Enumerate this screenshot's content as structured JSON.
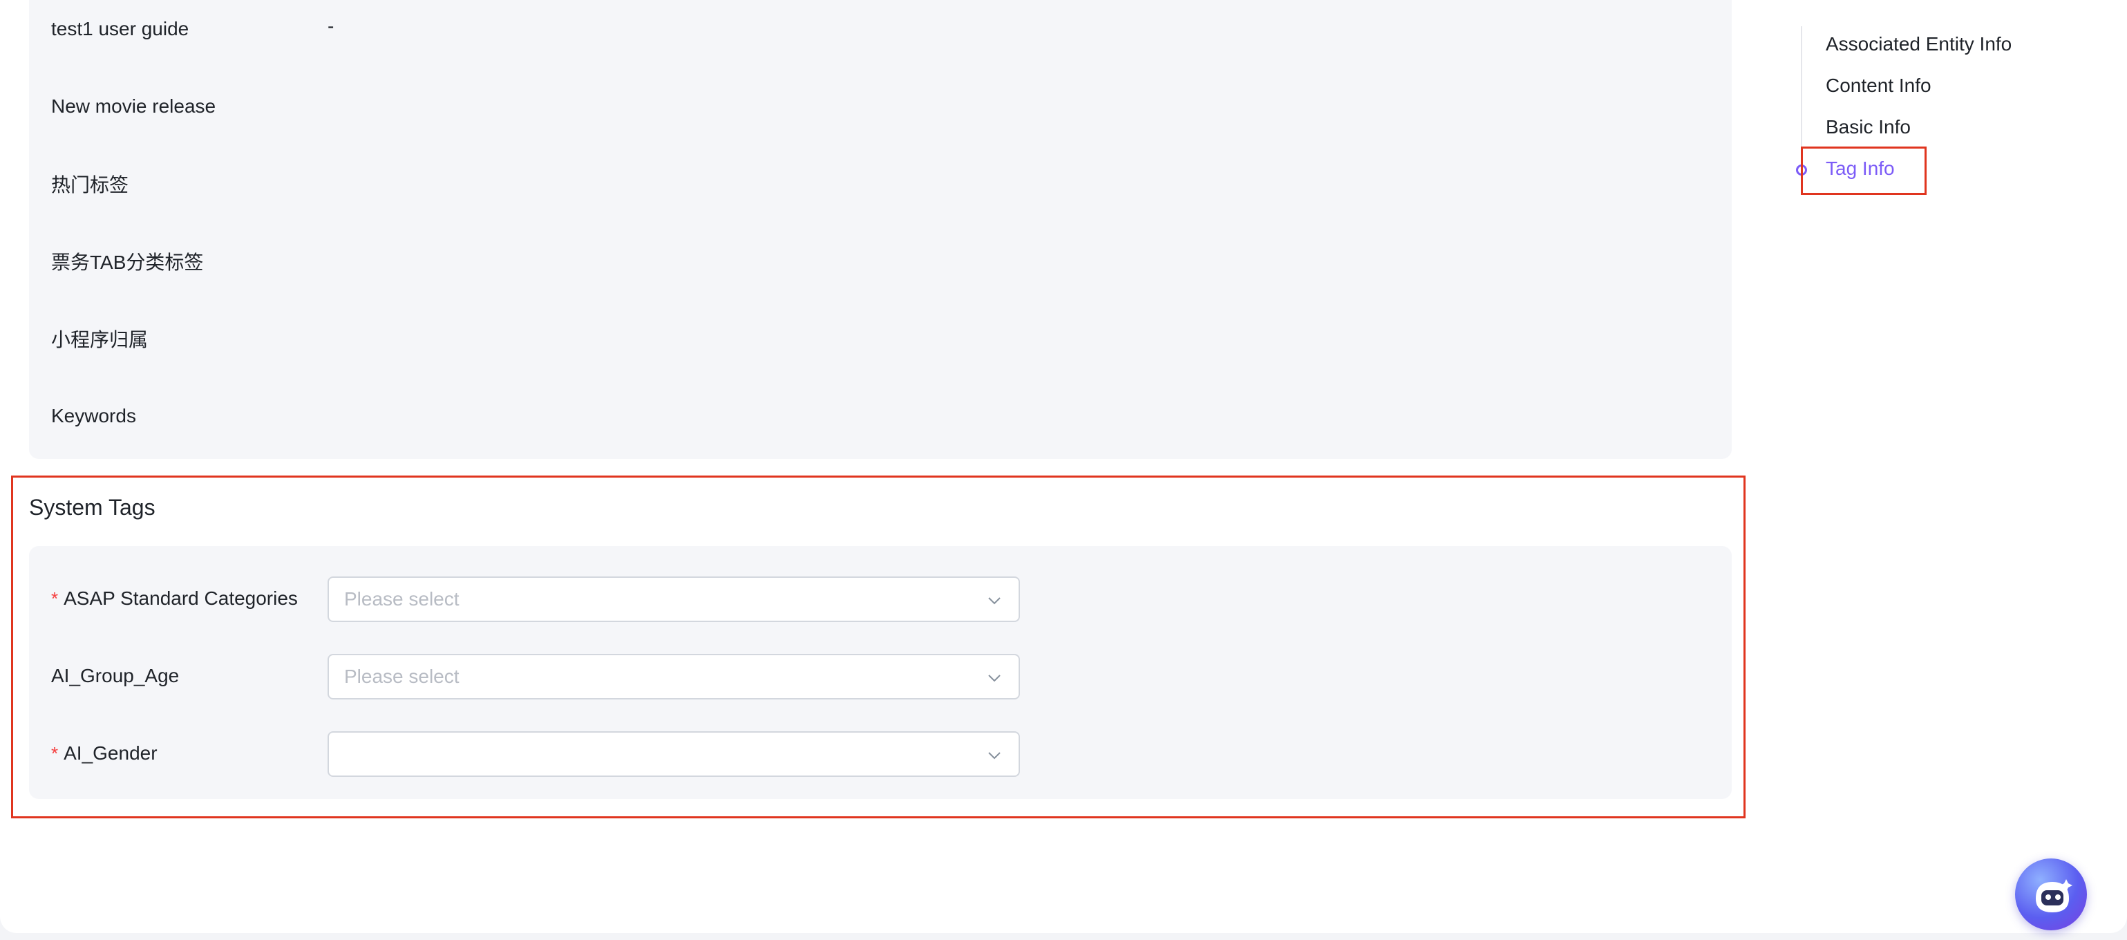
{
  "custom_tags": {
    "rows": [
      {
        "label": "test1 user guide",
        "value": "-"
      },
      {
        "label": "New movie release",
        "value": ""
      },
      {
        "label": "热门标签",
        "value": ""
      },
      {
        "label": "票务TAB分类标签",
        "value": ""
      },
      {
        "label": "小程序归属",
        "value": ""
      },
      {
        "label": "Keywords",
        "value": ""
      }
    ]
  },
  "system_tags": {
    "title": "System Tags",
    "fields": [
      {
        "label": "ASAP Standard Categories",
        "required": true,
        "placeholder": "Please select",
        "value": ""
      },
      {
        "label": "AI_Group_Age",
        "required": false,
        "placeholder": "Please select",
        "value": ""
      },
      {
        "label": "AI_Gender",
        "required": true,
        "placeholder": "",
        "value": ""
      }
    ],
    "required_mark": "*"
  },
  "anchor_nav": {
    "items": [
      {
        "label": "Associated Entity Info",
        "active": false
      },
      {
        "label": "Content Info",
        "active": false
      },
      {
        "label": "Basic Info",
        "active": false
      },
      {
        "label": "Tag Info",
        "active": true
      }
    ]
  },
  "colors": {
    "accent": "#7c5cf7",
    "highlight": "#e0351f",
    "required": "#f53f3f",
    "panel_bg": "#f5f6f9"
  },
  "icons": {
    "select_chevron": "chevron-down-icon",
    "assistant": "robot-assistant-icon"
  }
}
